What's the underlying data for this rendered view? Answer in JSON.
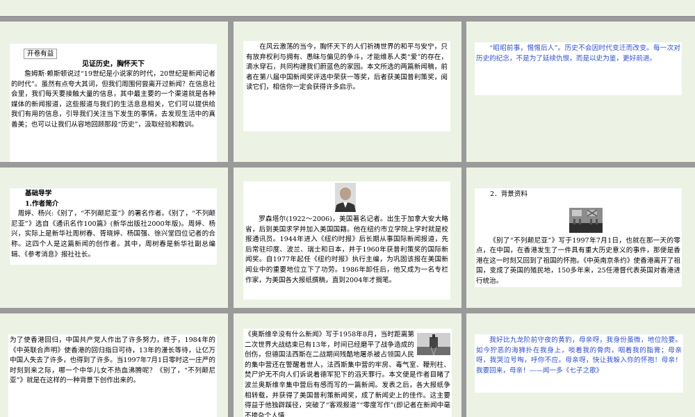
{
  "s1": {
    "label": "开卷有益",
    "title": "见证历史，胸怀天下",
    "body": "詹姆斯·赖斯顿说过“19世纪是小说家的时代，20世纪是新闻记者的时代”。虽然有点夸大其词，但我们周围何尝离开过新闻？在信息社会里，我们每天要接触大量的信息，其中最主要的一个渠道就是各种媒体的新闻报道，这些报道与我们的生活息息相关，它们可以提供给我们有用的信息，引导我们关注当下发生的事情，去发现生活中的真善美；也可以让我们从容地回顾那段“历史”，汲取经验和教训。"
  },
  "s2": {
    "body": "在风云激荡的当今，胸怀天下的人们祈祷世界的和平与安宁，只有放弃权利与拥有、愚昧与偏见的争斗，才能维系人类“爱”的存在，滴水穿石，共同构建我们蔚蓝色的家园。本文所选的两篇新闻稿，前者在第八届中国新闻奖评选中荣获一等奖，后者获美国普利策奖，阅读它们，相信你一定会获得许多启示。"
  },
  "s3": {
    "body": "“昭昭前事，惕惕后人”。历史不会因时代变迁而改变。每一次对历史的纪念，不是为了延续仇恨，而是以史为鉴，更好前进。"
  },
  "s4": {
    "heading": "基础导学",
    "subheading": "1.作者简介",
    "body": "周婷、杨兴:《别了，“不列颠尼亚”》的署名作者。《别了，“不列颠尼亚”》选自《通讯名作100篇》(新华出版社2000年版)。周婷、杨兴，实际上是新华社周树春、胥晓婷、杨国强、徐兴堂四位记者的合称。这四个人是这篇新闻的创作者。其中，周树春是新华社副总编辑、《参考消息》报社社长。"
  },
  "s5": {
    "body": "罗森塔尔(1922～2006)，美国著名记者。出生于加拿大安大略省，后到美国求学并加入美国国籍。他在纽约市立学院上学时就是校报通讯员。1944年进入《纽约时报》后长期从事国际新闻报道，先后常驻印度、波兰、瑞士和日本，并于1960年获普利策奖的国际新闻奖。自1977年起任《纽约时报》执行主编，为巩固该报在美国新闻业中的重要地位立下了功劳。1986年卸任后，他又成为一名专栏作家，为美国各大报纸撰稿，直到2004年才搁笔。"
  },
  "s6": {
    "heading": "2．背景资料",
    "body": "《别了“不列颠尼亚”》写于1997年7月1日，也就在那一天的零点，在中国，在香港发生了一件具有重大历史意义的事件，那便是香港在这一时刻又回到了祖国的怀抱。《中英南京条约》使香港离开了祖国，变成了英国的殖民地，150多年来，25任港督代表英国对香港进行统治。"
  },
  "s7": {
    "body": "为了使香港回归，中国共产党人作出了许多努力，终于，1984年的《中英联合声明》使香港的回归指日可待，13年的漫长等待，让亿万中国人失去了许多，也得到了许多。当1997年7月1日零时这一庄严的时刻到来之际，哪一个中华儿女不热血沸腾呢？《别了，“不列颠尼亚”》就是在这样的一种背景下创作出来的。"
  },
  "s8": {
    "body": "《奥斯维辛没有什么新闻》写于1958年8月，当时距离第二次世界大战结束已有13年，时间已经磨平了战争造成的创伤，但德国法西斯在二战期间残酷地屠杀被占领国人民的集中营还在警醒着世人，法西斯集中营的牢房、毒气室、鞭刑柱、焚尸炉无不向人们诉说着德军犯下的滔天罪行。本文便是作者目睹了波兰奥斯维辛集中营后有感而写的一篇新闻。发表之后，各大报纸争相转载，并获得了美国普利策新闻奖，成了新闻史上的佳作。这主要得益于他独辟蹊径，突破了“客观报道”“零度写作”(即记者在新闻中毫不掺杂个人情"
  },
  "s9": {
    "body": "我好比九龙阶前守夜的黄豹，母亲呀，我身份虽微，地位险要。如今狞恶的海狮扑在我身上，啖着我的骨肉，咽着我的脂膏；母亲呀，我哭泣号啕，呼你不应。母亲呀，快让我躲入你的怀抱！母亲！我要回来，母亲！——闻一多《七子之歌》"
  }
}
